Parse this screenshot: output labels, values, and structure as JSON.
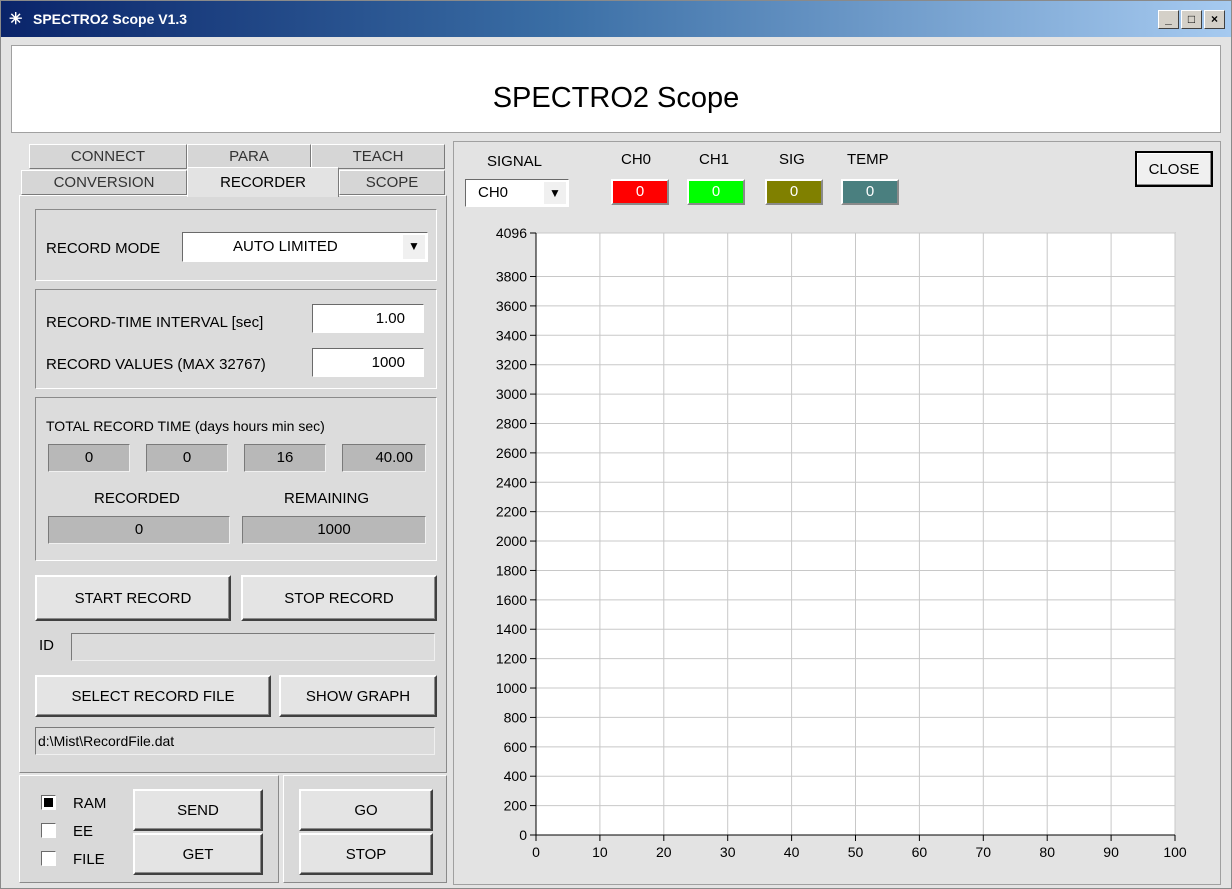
{
  "window": {
    "title": "SPECTRO2 Scope V1.3",
    "icon": "sparkle-icon",
    "controls": [
      "_",
      "□",
      "×"
    ]
  },
  "header": {
    "title": "SPECTRO2 Scope"
  },
  "tabs": {
    "row1": [
      "CONNECT",
      "PARA",
      "TEACH"
    ],
    "row2": [
      "CONVERSION",
      "RECORDER",
      "SCOPE"
    ],
    "active": "RECORDER"
  },
  "recorder": {
    "record_mode_label": "RECORD MODE",
    "record_mode_value": "AUTO LIMITED",
    "interval_label": "RECORD-TIME INTERVAL [sec]",
    "interval_value": "1.00",
    "values_label": "RECORD VALUES (MAX 32767)",
    "values_value": "1000",
    "total_label": "TOTAL RECORD TIME (days  hours  min sec)",
    "total_days": "0",
    "total_hours": "0",
    "total_min": "16",
    "total_sec": "40.00",
    "recorded_label": "RECORDED",
    "recorded_value": "0",
    "remaining_label": "REMAINING",
    "remaining_value": "1000",
    "start_button": "START RECORD",
    "stop_button": "STOP RECORD",
    "id_label": "ID",
    "id_value": "",
    "select_file_button": "SELECT RECORD FILE",
    "show_graph_button": "SHOW GRAPH",
    "file_path": "d:\\Mist\\RecordFile.dat"
  },
  "bottom": {
    "ram_label": "RAM",
    "ram_checked": true,
    "ee_label": "EE",
    "ee_checked": false,
    "file_label": "FILE",
    "file_checked": false,
    "send_button": "SEND",
    "get_button": "GET",
    "go_button": "GO",
    "stop_button": "STOP"
  },
  "scope": {
    "signal_label": "SIGNAL",
    "signal_value": "CH0",
    "close_button": "CLOSE",
    "indicators": [
      {
        "label": "CH0",
        "value": "0",
        "color": "#ff0000"
      },
      {
        "label": "CH1",
        "value": "0",
        "color": "#00ff00"
      },
      {
        "label": "SIG",
        "value": "0",
        "color": "#808000"
      },
      {
        "label": "TEMP",
        "value": "0",
        "color": "#4a7f7f"
      }
    ]
  },
  "chart_data": {
    "type": "line",
    "series": [],
    "xlim": [
      0,
      100
    ],
    "ylim": [
      0,
      4096
    ],
    "x_ticks": [
      0,
      10,
      20,
      30,
      40,
      50,
      60,
      70,
      80,
      90,
      100
    ],
    "y_ticks": [
      0,
      200,
      400,
      600,
      800,
      1000,
      1200,
      1400,
      1600,
      1800,
      2000,
      2200,
      2400,
      2600,
      2800,
      3000,
      3200,
      3400,
      3600,
      3800,
      4096
    ],
    "grid": true,
    "background": "#ffffff",
    "grid_color": "#c8c8c8"
  }
}
